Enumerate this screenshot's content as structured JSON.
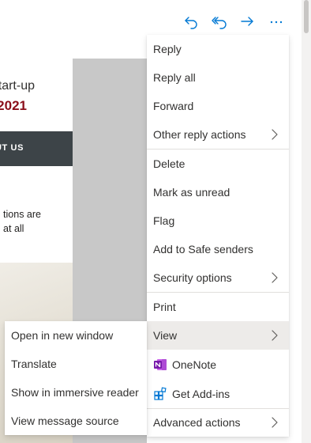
{
  "toolbar": {
    "buttons": [
      {
        "name": "reply",
        "icon": "reply-icon"
      },
      {
        "name": "reply-all",
        "icon": "reply-all-icon"
      },
      {
        "name": "forward",
        "icon": "forward-icon"
      },
      {
        "name": "more",
        "icon": "more-icon"
      }
    ],
    "accent": "#0078d4"
  },
  "email": {
    "heading_line_1": "tart-up",
    "heading_line_2": "2021",
    "banner_text": "UT US",
    "paragraph_line_1": "tions are",
    "paragraph_line_2": "at all",
    "heading_color": "#8b0f1a",
    "banner_color": "#3d4448"
  },
  "menu": {
    "items": [
      {
        "label": "Reply"
      },
      {
        "label": "Reply all"
      },
      {
        "label": "Forward"
      },
      {
        "label": "Other reply actions",
        "submenu": true
      },
      {
        "label": "Delete"
      },
      {
        "label": "Mark as unread"
      },
      {
        "label": "Flag"
      },
      {
        "label": "Add to Safe senders"
      },
      {
        "label": "Security options",
        "submenu": true
      },
      {
        "label": "Print"
      },
      {
        "label": "View",
        "submenu": true,
        "active": true
      },
      {
        "label": "OneNote",
        "icon": "onenote-icon"
      },
      {
        "label": "Get Add-ins",
        "icon": "add-ins-icon"
      },
      {
        "label": "Advanced actions",
        "submenu": true
      }
    ]
  },
  "submenu": {
    "items": [
      {
        "label": "Open in new window"
      },
      {
        "label": "Translate"
      },
      {
        "label": "Show in immersive reader"
      },
      {
        "label": "View message source"
      }
    ]
  }
}
